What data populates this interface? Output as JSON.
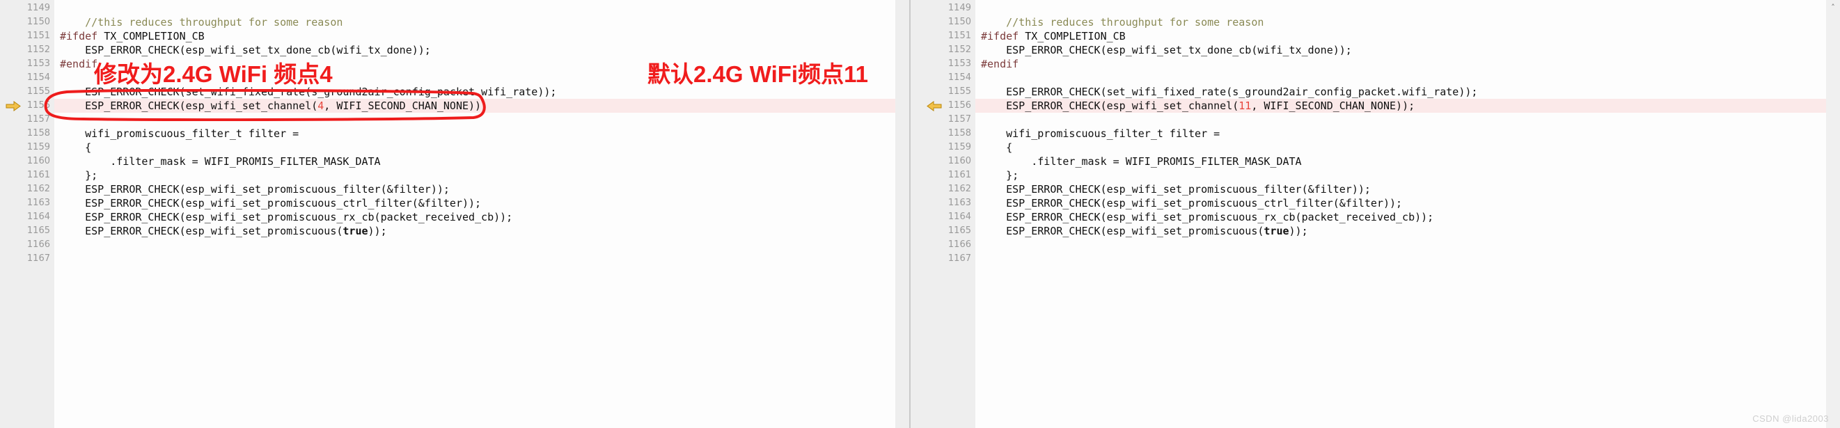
{
  "watermark": "CSDN @lida2003",
  "colors": {
    "annotation_red": "#f01c1c",
    "highlight_row": "#fbe9e9",
    "gutter_bg": "#eeeeee",
    "number_literal": "#e8453c",
    "comment": "#8a8a55",
    "preprocessor": "#7c3b3b",
    "marker_arrow": "#f0c040"
  },
  "left_panel": {
    "name": "modified-code-panel",
    "scrollbar": {
      "up_arrow": "˄"
    },
    "annotation": {
      "text": "修改为2.4G WiFi 频点4",
      "shape": "red-oval-outline-around-line-1156"
    },
    "current_line": 1156,
    "marker_direction": "right",
    "lines": [
      {
        "num": "1149",
        "segments": []
      },
      {
        "num": "1150",
        "segments": [
          {
            "t": "    ",
            "c": ""
          },
          {
            "t": "//this reduces throughput for some reason",
            "c": "tok-comment"
          }
        ]
      },
      {
        "num": "1151",
        "segments": [
          {
            "t": "#ifdef",
            "c": "tok-pre"
          },
          {
            "t": " TX_COMPLETION_CB",
            "c": ""
          }
        ]
      },
      {
        "num": "1152",
        "segments": [
          {
            "t": "    ESP_ERROR_CHECK(esp_wifi_set_tx_done_cb(wifi_tx_done));",
            "c": ""
          }
        ]
      },
      {
        "num": "1153",
        "segments": [
          {
            "t": "#endif",
            "c": "tok-pre"
          }
        ]
      },
      {
        "num": "1154",
        "segments": []
      },
      {
        "num": "1155",
        "segments": [
          {
            "t": "    ESP_ERROR_CHECK(set_wifi_fixed_rate(s_ground2air_config_packet.wifi_rate));",
            "c": ""
          }
        ]
      },
      {
        "num": "1156",
        "highlight": true,
        "marker": true,
        "segments": [
          {
            "t": "    ESP_ERROR_CHECK(esp_wifi_set_channel(",
            "c": ""
          },
          {
            "t": "4",
            "c": "tok-num"
          },
          {
            "t": ", WIFI_SECOND_CHAN_NONE));",
            "c": ""
          }
        ]
      },
      {
        "num": "1157",
        "segments": []
      },
      {
        "num": "1158",
        "segments": [
          {
            "t": "    wifi_promiscuous_filter_t filter =",
            "c": ""
          }
        ]
      },
      {
        "num": "1159",
        "segments": [
          {
            "t": "    {",
            "c": ""
          }
        ]
      },
      {
        "num": "1160",
        "segments": [
          {
            "t": "        .filter_mask = WIFI_PROMIS_FILTER_MASK_DATA",
            "c": ""
          }
        ]
      },
      {
        "num": "1161",
        "segments": [
          {
            "t": "    };",
            "c": ""
          }
        ]
      },
      {
        "num": "1162",
        "segments": [
          {
            "t": "    ESP_ERROR_CHECK(esp_wifi_set_promiscuous_filter(&filter));",
            "c": ""
          }
        ]
      },
      {
        "num": "1163",
        "segments": [
          {
            "t": "    ESP_ERROR_CHECK(esp_wifi_set_promiscuous_ctrl_filter(&filter));",
            "c": ""
          }
        ]
      },
      {
        "num": "1164",
        "segments": [
          {
            "t": "    ESP_ERROR_CHECK(esp_wifi_set_promiscuous_rx_cb(packet_received_cb));",
            "c": ""
          }
        ]
      },
      {
        "num": "1165",
        "segments": [
          {
            "t": "    ESP_ERROR_CHECK(esp_wifi_set_promiscuous(",
            "c": ""
          },
          {
            "t": "true",
            "c": "tok-kw"
          },
          {
            "t": "));",
            "c": ""
          }
        ]
      },
      {
        "num": "1166",
        "segments": []
      },
      {
        "num": "1167",
        "segments": []
      }
    ]
  },
  "right_panel": {
    "name": "default-code-panel",
    "scrollbar": {
      "up_arrow": "˄"
    },
    "annotation": {
      "text": "默认2.4G WiFi频点11",
      "shape": "none"
    },
    "current_line": 1156,
    "marker_direction": "left",
    "lines": [
      {
        "num": "1149",
        "segments": []
      },
      {
        "num": "1150",
        "segments": [
          {
            "t": "    ",
            "c": ""
          },
          {
            "t": "//this reduces throughput for some reason",
            "c": "tok-comment"
          }
        ]
      },
      {
        "num": "1151",
        "segments": [
          {
            "t": "#ifdef",
            "c": "tok-pre"
          },
          {
            "t": " TX_COMPLETION_CB",
            "c": ""
          }
        ]
      },
      {
        "num": "1152",
        "segments": [
          {
            "t": "    ESP_ERROR_CHECK(esp_wifi_set_tx_done_cb(wifi_tx_done));",
            "c": ""
          }
        ]
      },
      {
        "num": "1153",
        "segments": [
          {
            "t": "#endif",
            "c": "tok-pre"
          }
        ]
      },
      {
        "num": "1154",
        "segments": []
      },
      {
        "num": "1155",
        "segments": [
          {
            "t": "    ESP_ERROR_CHECK(set_wifi_fixed_rate(s_ground2air_config_packet.wifi_rate));",
            "c": ""
          }
        ]
      },
      {
        "num": "1156",
        "highlight": true,
        "marker": true,
        "segments": [
          {
            "t": "    ESP_ERROR_CHECK(esp_wifi_set_channel(",
            "c": ""
          },
          {
            "t": "11",
            "c": "tok-num"
          },
          {
            "t": ", WIFI_SECOND_CHAN_NONE));",
            "c": ""
          }
        ]
      },
      {
        "num": "1157",
        "segments": []
      },
      {
        "num": "1158",
        "segments": [
          {
            "t": "    wifi_promiscuous_filter_t filter =",
            "c": ""
          }
        ]
      },
      {
        "num": "1159",
        "segments": [
          {
            "t": "    {",
            "c": ""
          }
        ]
      },
      {
        "num": "1160",
        "segments": [
          {
            "t": "        .filter_mask = WIFI_PROMIS_FILTER_MASK_DATA",
            "c": ""
          }
        ]
      },
      {
        "num": "1161",
        "segments": [
          {
            "t": "    };",
            "c": ""
          }
        ]
      },
      {
        "num": "1162",
        "segments": [
          {
            "t": "    ESP_ERROR_CHECK(esp_wifi_set_promiscuous_filter(&filter));",
            "c": ""
          }
        ]
      },
      {
        "num": "1163",
        "segments": [
          {
            "t": "    ESP_ERROR_CHECK(esp_wifi_set_promiscuous_ctrl_filter(&filter));",
            "c": ""
          }
        ]
      },
      {
        "num": "1164",
        "segments": [
          {
            "t": "    ESP_ERROR_CHECK(esp_wifi_set_promiscuous_rx_cb(packet_received_cb));",
            "c": ""
          }
        ]
      },
      {
        "num": "1165",
        "segments": [
          {
            "t": "    ESP_ERROR_CHECK(esp_wifi_set_promiscuous(",
            "c": ""
          },
          {
            "t": "true",
            "c": "tok-kw"
          },
          {
            "t": "));",
            "c": ""
          }
        ]
      },
      {
        "num": "1166",
        "segments": []
      },
      {
        "num": "1167",
        "segments": []
      }
    ]
  }
}
